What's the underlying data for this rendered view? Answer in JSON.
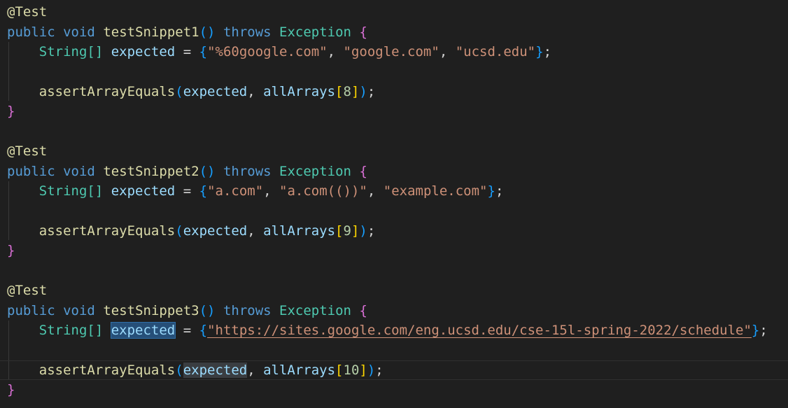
{
  "code": {
    "annotation": "@Test",
    "kw_public": "public",
    "kw_void": "void",
    "kw_throws": "throws",
    "exception_type": "Exception",
    "string_array_type": "String[]",
    "var_expected": "expected",
    "assert_fn": "assertArrayEquals",
    "all_arrays": "allArrays",
    "tests": [
      {
        "name": "testSnippet1",
        "strings": [
          "\"%60google.com\"",
          "\"google.com\"",
          "\"ucsd.edu\""
        ],
        "index": "8"
      },
      {
        "name": "testSnippet2",
        "strings": [
          "\"a.com\"",
          "\"a.com(())\"",
          "\"example.com\""
        ],
        "index": "9"
      },
      {
        "name": "testSnippet3",
        "strings": [
          "\"https://sites.google.com/eng.ucsd.edu/cse-15l-spring-2022/schedule\""
        ],
        "index": "10"
      }
    ]
  },
  "colors": {
    "background": "#1f1f1f",
    "keyword": "#569cd6",
    "function": "#dcdcaa",
    "type": "#4ec9b0",
    "variable": "#9cdcfe",
    "string": "#ce9178",
    "bracket_level1": "#da70d6",
    "bracket_level2": "#179fff",
    "bracket_level3": "#ffd700"
  }
}
